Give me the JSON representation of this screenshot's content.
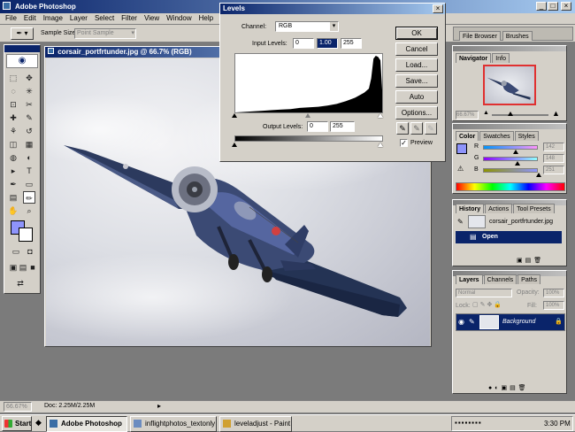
{
  "app": {
    "title": "Adobe Photoshop"
  },
  "menu": [
    "File",
    "Edit",
    "Image",
    "Layer",
    "Select",
    "Filter",
    "View",
    "Window",
    "Help"
  ],
  "options_bar": {
    "sample_size_label": "Sample Size:",
    "sample_size_value": "Point Sample"
  },
  "palette_well": {
    "tabs": [
      "File Browser",
      "Brushes"
    ]
  },
  "document": {
    "title": "corsair_portfrtunder.jpg @ 66.7% (RGB)",
    "zoom": "66.67%",
    "doc_size": "Doc: 2.25M/2.25M"
  },
  "levels": {
    "title": "Levels",
    "channel_label": "Channel:",
    "channel_value": "RGB",
    "input_label": "Input Levels:",
    "input_values": [
      "0",
      "1.00",
      "255"
    ],
    "output_label": "Output Levels:",
    "output_values": [
      "0",
      "255"
    ],
    "buttons": [
      "OK",
      "Cancel",
      "Load...",
      "Save...",
      "Auto",
      "Options..."
    ],
    "preview_label": "Preview",
    "preview_checked": true
  },
  "navigator": {
    "tabs": [
      "Navigator",
      "Info"
    ],
    "zoom": "66.67%"
  },
  "color": {
    "tabs": [
      "Color",
      "Swatches",
      "Styles"
    ],
    "channels": [
      {
        "label": "R",
        "value": "142"
      },
      {
        "label": "G",
        "value": "148"
      },
      {
        "label": "B",
        "value": "251"
      }
    ],
    "foreground": "#8e94fb"
  },
  "history": {
    "tabs": [
      "History",
      "Actions",
      "Tool Presets"
    ],
    "snapshot": "corsair_portfrtunder.jpg",
    "items": [
      "Open"
    ]
  },
  "layers": {
    "tabs": [
      "Layers",
      "Channels",
      "Paths"
    ],
    "blend": "Normal",
    "opacity_label": "Opacity:",
    "opacity": "100%",
    "lock_label": "Lock:",
    "fill_label": "Fill:",
    "fill": "100%",
    "items": [
      "Background"
    ]
  },
  "taskbar": {
    "start": "Start",
    "tasks": [
      "Adobe Photoshop",
      "inflightphotos_textonly - Mi...",
      "leveladjust - Paint"
    ],
    "clock": "3:30 PM"
  },
  "chart_data": {
    "type": "area",
    "x": [
      0,
      16,
      32,
      48,
      64,
      80,
      96,
      112,
      128,
      144,
      160,
      176,
      192,
      208,
      224,
      232,
      236,
      240,
      244,
      248,
      252,
      255
    ],
    "values": [
      0,
      1,
      2,
      3,
      4,
      5,
      6,
      8,
      9,
      10,
      12,
      15,
      20,
      26,
      35,
      42,
      60,
      95,
      100,
      98,
      92,
      40
    ],
    "xlim": [
      0,
      255
    ],
    "ylim": [
      0,
      100
    ]
  }
}
